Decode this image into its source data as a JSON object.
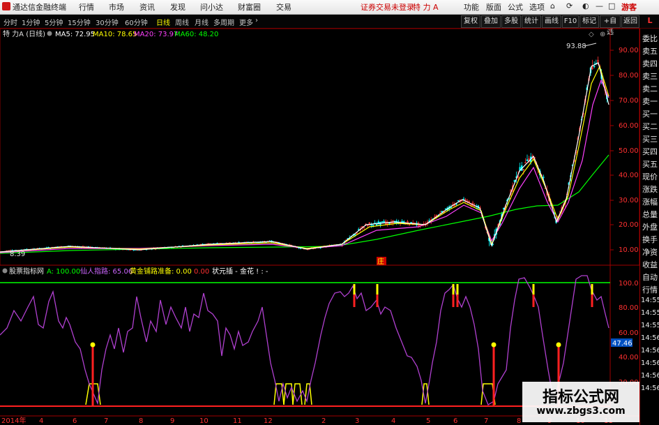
{
  "menubar": {
    "app_title": "通达信金融终端",
    "menus": [
      "行情",
      "市场",
      "资讯",
      "发现",
      "问小达",
      "财富圈",
      "交易"
    ],
    "status": "证券交易未登录",
    "stock": "特 力 A",
    "right_menus": [
      "功能",
      "版面",
      "公式",
      "选项"
    ],
    "guest": "游客"
  },
  "toolbar": {
    "periods": [
      "分时",
      "1分钟",
      "5分钟",
      "15分钟",
      "30分钟",
      "60分钟",
      "日线",
      "周线",
      "月线",
      "多周期",
      "更多"
    ],
    "active_period": "日线",
    "buttons": [
      "复权",
      "叠加",
      "多股",
      "统计",
      "画线",
      "F10",
      "标记",
      "+自选",
      "返回"
    ]
  },
  "main_panel": {
    "title": "特 力A (日线)",
    "ma_labels": [
      {
        "text": "MA5: 72.95",
        "color": "#ffffff"
      },
      {
        "text": "MA10: 78.65",
        "color": "#ffff00"
      },
      {
        "text": "MA20: 73.97",
        "color": "#ff40ff"
      },
      {
        "text": "MA60: 48.20",
        "color": "#00ff00"
      }
    ],
    "high_label": "93.88",
    "low_label": "8.39",
    "y_ticks": [
      "90.00",
      "80.00",
      "70.00",
      "60.00",
      "50.00",
      "40.00",
      "30.00",
      "20.00",
      "10.00"
    ],
    "marker": "庄"
  },
  "indicator_panel": {
    "title": "股票指标网",
    "labels": [
      {
        "text": "A: 100.00",
        "color": "#00ff00"
      },
      {
        "text": "仙人指路: 65.06",
        "color": "#cc66ff"
      },
      {
        "text": "黄金铺路准备: 0.00",
        "color": "#ffff00"
      },
      {
        "text": "0.00",
        "color": "#ff3030"
      },
      {
        "text": "状元插 - 金花 ! : -",
        "color": "#ffffff"
      }
    ],
    "y_ticks": [
      "100.0",
      "80.00",
      "60.00",
      "40.00",
      "20.00"
    ],
    "current_value": "47.46"
  },
  "x_axis": {
    "labels": [
      "2014年",
      "4",
      "6",
      "7",
      "8",
      "9",
      "10",
      "11",
      "12",
      "2",
      "3",
      "4",
      "5",
      "6",
      "7",
      "8",
      "9",
      "10",
      "11"
    ]
  },
  "right_panel": {
    "header": "L",
    "items": [
      "委比",
      "卖五",
      "卖四",
      "卖三",
      "卖二",
      "卖一",
      "买一",
      "买二",
      "买三",
      "买四",
      "买五",
      "现价",
      "涨跌",
      "涨幅",
      "总量",
      "外盘",
      "换手",
      "净资",
      "收益",
      "自动",
      "行情",
      "14:55",
      "14:55",
      "14:55",
      "14:56",
      "14:56",
      "14:56",
      "14:56",
      "14:56"
    ]
  },
  "watermark": {
    "title": "指标公式网",
    "url": "www.zbgs3.com"
  },
  "colors": {
    "candle_up": "#ff3333",
    "candle_down": "#00ffff",
    "ma5": "#ffffff",
    "ma10": "#ffff00",
    "ma20": "#ff40ff",
    "ma60": "#00ff00",
    "indicator": "#b040d0",
    "bar": "#ff2020",
    "gold": "#ffff00"
  }
}
